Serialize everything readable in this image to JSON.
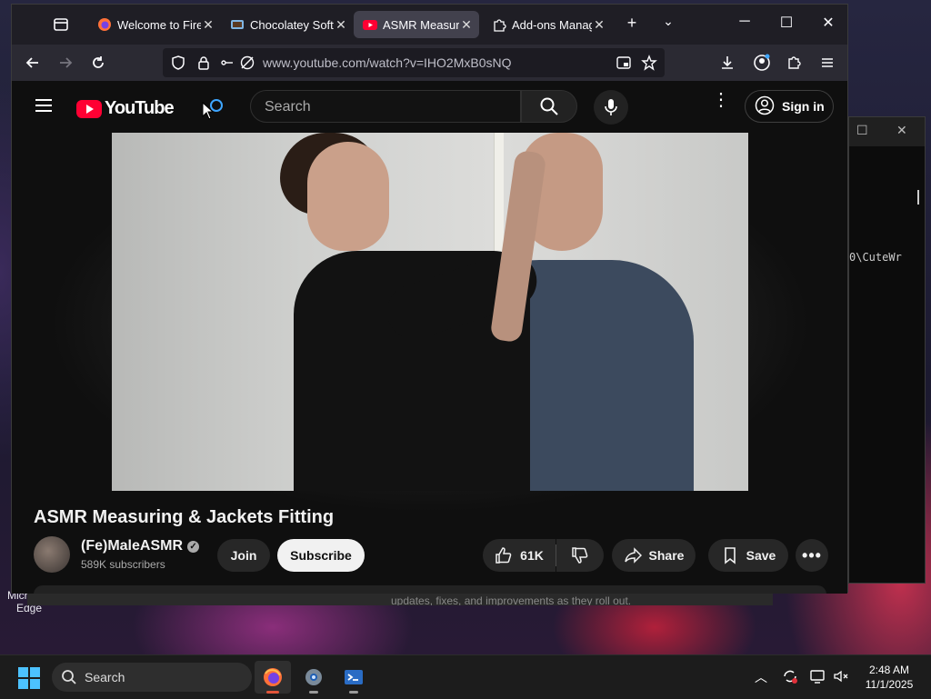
{
  "desktop": {
    "icon_labels": [
      "Microsoft Edge"
    ],
    "terminal": {
      "path_text": "0\\CuteWr"
    },
    "notification_text": "updates, fixes, and improvements as they roll out."
  },
  "browser": {
    "tabs": [
      {
        "title": "Welcome to Firefox",
        "favicon": "firefox-icon",
        "active": false
      },
      {
        "title": "Chocolatey Software",
        "favicon": "chocolatey-icon",
        "active": false
      },
      {
        "title": "ASMR Measuring",
        "favicon": "youtube-icon",
        "active": true
      },
      {
        "title": "Add-ons Manager",
        "favicon": "puzzle-icon",
        "active": false
      }
    ],
    "new_tab_symbol": "+",
    "url": "www.youtube.com/watch?v=IHO2MxB0sNQ"
  },
  "youtube": {
    "logo_text": "YouTube",
    "search_placeholder": "Search",
    "sign_in_label": "Sign in",
    "video": {
      "title": "ASMR Measuring & Jackets Fitting",
      "channel": "(Fe)MaleASMR",
      "subscribers": "589K subscribers",
      "join_label": "Join",
      "subscribe_label": "Subscribe",
      "likes": "61K",
      "share_label": "Share",
      "save_label": "Save"
    }
  },
  "taskbar": {
    "search_label": "Search",
    "time": "2:48 AM",
    "date": "11/1/2025"
  },
  "colors": {
    "youtube_red": "#ff0033",
    "tab_active": "#42414d",
    "accent_blue": "#3ea6ff"
  }
}
